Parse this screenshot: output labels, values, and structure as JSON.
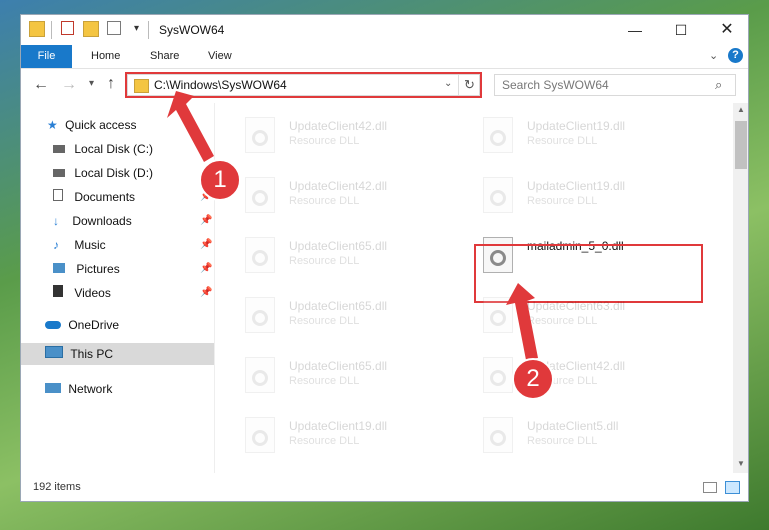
{
  "window": {
    "title": "SysWOW64"
  },
  "ribbon": {
    "tabs": [
      "File",
      "Home",
      "Share",
      "View"
    ]
  },
  "address": {
    "path": "C:\\Windows\\SysWOW64"
  },
  "search": {
    "placeholder": "Search SysWOW64"
  },
  "nav": {
    "quick_access": "Quick access",
    "items": [
      "Local Disk (C:)",
      "Local Disk (D:)",
      "Documents",
      "Downloads",
      "Music",
      "Pictures",
      "Videos"
    ],
    "onedrive": "OneDrive",
    "thispc": "This PC",
    "network": "Network"
  },
  "files": {
    "type": "Resource DLL",
    "col1": [
      "UpdateClient42.dll",
      "UpdateClient42.dll",
      "UpdateClient65.dll",
      "UpdateClient65.dll",
      "UpdateClient65.dll",
      "UpdateClient19.dll"
    ],
    "col2": [
      "UpdateClient19.dll",
      "UpdateClient19.dll",
      "UpdateClient63.dll",
      "UpdateClient42.dll",
      "UpdateClient5.dll"
    ],
    "highlight": "mailadmin_5_0.dll"
  },
  "callouts": {
    "one": "1",
    "two": "2"
  },
  "status": {
    "count": "192 items"
  },
  "colors": {
    "accent": "#1979ca",
    "callout": "#e0393b",
    "selected": "#cce8ff"
  }
}
